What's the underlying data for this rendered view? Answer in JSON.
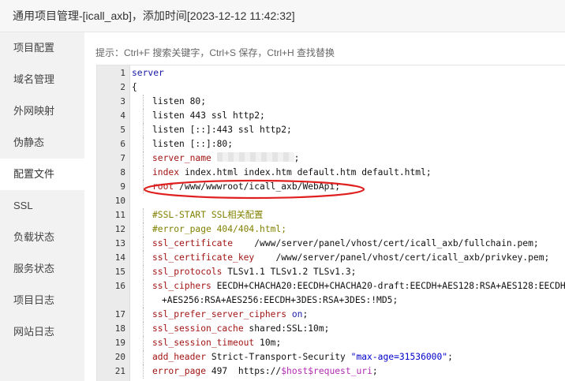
{
  "title": "通用项目管理-[icall_axb]，添加时间[2023-12-12 11:42:32]",
  "sidebar": {
    "items": [
      {
        "label": "项目配置",
        "name": "sidebar-item-project-config"
      },
      {
        "label": "域名管理",
        "name": "sidebar-item-domain-management"
      },
      {
        "label": "外网映射",
        "name": "sidebar-item-external-mapping"
      },
      {
        "label": "伪静态",
        "name": "sidebar-item-rewrite"
      },
      {
        "label": "配置文件",
        "name": "sidebar-item-config-file"
      },
      {
        "label": "SSL",
        "name": "sidebar-item-ssl"
      },
      {
        "label": "负载状态",
        "name": "sidebar-item-load-status"
      },
      {
        "label": "服务状态",
        "name": "sidebar-item-service-status"
      },
      {
        "label": "项目日志",
        "name": "sidebar-item-project-log"
      },
      {
        "label": "网站日志",
        "name": "sidebar-item-site-log"
      }
    ],
    "active_index": 4
  },
  "hint": "提示：Ctrl+F 搜索关键字，Ctrl+S 保存，Ctrl+H 查找替换",
  "editor": {
    "line_numbers": [
      "1",
      "2",
      "3",
      "4",
      "5",
      "6",
      "7",
      "8",
      "9",
      "10",
      "11",
      "12",
      "13",
      "14",
      "15",
      "16",
      "17",
      "18",
      "19",
      "20",
      "21"
    ],
    "line1": "server",
    "line2": "{",
    "line3": {
      "kw": "listen",
      "rest": " 80;"
    },
    "line4": {
      "kw": "listen",
      "rest": " 443 ssl http2;"
    },
    "line5": {
      "kw": "listen",
      "rest": " [::]:443 ssl http2;"
    },
    "line6": {
      "kw": "listen",
      "rest": " [::]:80;"
    },
    "line7": {
      "kw": "server_name",
      "rest": ";"
    },
    "line8": {
      "kw": "index",
      "rest": " index.html index.htm default.htm default.html;"
    },
    "line9": {
      "kw": "root",
      "rest": " /www/wwwroot/icall_axb/WebApi;"
    },
    "line10": "",
    "line11": {
      "cmt": "#SSL-START SSL相关配置"
    },
    "line12": {
      "cmt": "#error_page 404/404.html;"
    },
    "line13": {
      "kw": "ssl_certificate",
      "rest": "    /www/server/panel/vhost/cert/icall_axb/fullchain.pem;"
    },
    "line14": {
      "kw": "ssl_certificate_key",
      "rest": "    /www/server/panel/vhost/cert/icall_axb/privkey.pem;"
    },
    "line15": {
      "kw": "ssl_protocols",
      "rest": " TLSv1.1 TLSv1.2 TLSv1.3;"
    },
    "line16": {
      "kw": "ssl_ciphers",
      "rest": " EECDH+CHACHA20:EECDH+CHACHA20-draft:EECDH+AES128:RSA+AES128:EECDH",
      "cont": "+AES256:RSA+AES256:EECDH+3DES:RSA+3DES:!MD5;"
    },
    "line17": {
      "kw": "ssl_prefer_server_ciphers",
      "val": " on",
      "rest": ";"
    },
    "line18": {
      "kw": "ssl_session_cache",
      "rest": " shared:SSL:10m;"
    },
    "line19": {
      "kw": "ssl_session_timeout",
      "rest": " 10m;"
    },
    "line20": {
      "kw": "add_header",
      "rest": " Strict-Transport-Security ",
      "str": "\"max-age=31536000\"",
      "end": ";"
    },
    "line21": {
      "kw": "error_page",
      "rest": " 497  https://",
      "var1": "$host",
      "var2": "$request_uri",
      "end": ";"
    }
  },
  "colors": {
    "keyword": "#a31515",
    "comment": "#808000",
    "string": "#0000cc",
    "variable": "#b22bb2",
    "annotation": "#e02020"
  }
}
